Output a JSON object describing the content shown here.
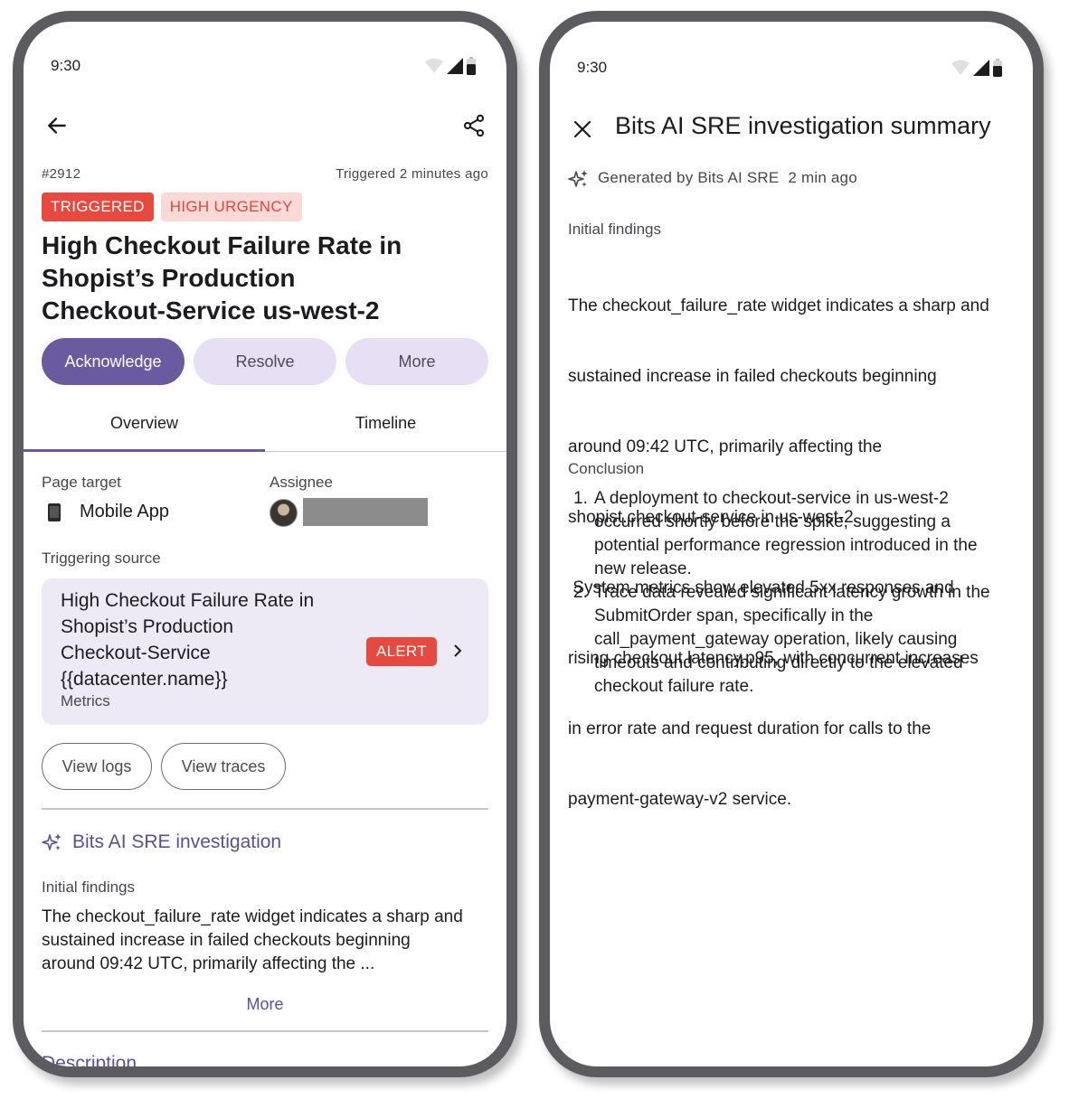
{
  "left": {
    "status_time": "9:30",
    "incident_id": "#2912",
    "triggered_time": "Triggered 2 minutes ago",
    "status_chip": "TRIGGERED",
    "urgency_chip": "HIGH URGENCY",
    "title_lines": [
      "High Checkout Failure Rate in",
      "Shopist’s Production",
      "Checkout-Service us-west-2"
    ],
    "actions": {
      "acknowledge": "Acknowledge",
      "resolve": "Resolve",
      "more": "More"
    },
    "tabs": [
      {
        "label": "Overview",
        "selected": true
      },
      {
        "label": "Timeline",
        "selected": false
      }
    ],
    "page_target_label": "Page target",
    "page_target_value": "Mobile App",
    "assignee_label": "Assignee",
    "triggering_source_label": "Triggering source",
    "source_card": {
      "lines": [
        "High Checkout Failure Rate in",
        "Shopist’s Production",
        "Checkout-Service",
        "{{datacenter.name}}"
      ],
      "subtitle": "Metrics",
      "badge": "ALERT"
    },
    "view_logs": "View logs",
    "view_traces": "View traces",
    "bits_title": "Bits AI SRE investigation",
    "initial_findings_label": "Initial findings",
    "findings_lines": [
      "The checkout_failure_rate widget indicates a sharp and",
      "sustained increase in failed checkouts beginning",
      "around 09:42 UTC, primarily affecting the ..."
    ],
    "more_link": "More",
    "description_label": "Description"
  },
  "right": {
    "status_time": "9:30",
    "title": "Bits AI SRE investigation summary",
    "generated_by": "Generated by Bits AI SRE",
    "generated_time": "2 min ago",
    "initial_findings_label": "Initial findings",
    "findings_lines": [
      "The checkout_failure_rate widget indicates a sharp and",
      "sustained increase in failed checkouts beginning",
      "around 09:42 UTC, primarily affecting the",
      "shopist.checkout-service in us-west-2.",
      " System metrics show elevated 5xx responses and",
      "rising checkout.latency.p95, with concurrent increases",
      "in error rate and request duration for calls to the",
      "payment-gateway-v2 service."
    ],
    "conclusion_label": "Conclusion",
    "conclusions": [
      {
        "num": "1.",
        "lines": [
          "A deployment to checkout-service in us-west-2",
          "occurred shortly before the spike, suggesting a",
          "potential performance regression introduced in the",
          "new release."
        ]
      },
      {
        "num": "2.",
        "lines": [
          "Trace data revealed significant latency growth in the",
          "SubmitOrder span, specifically in the",
          "call_payment_gateway operation, likely causing",
          "timeouts and contributing directly to the elevated",
          "checkout failure rate."
        ]
      }
    ]
  },
  "colors": {
    "accent": "#6a5a9f",
    "accent_text": "#5e4e95",
    "tonal": "#e7e0f4",
    "card": "#eeeaf5",
    "alert_red": "#e8493f",
    "urgency_bg": "#fbd9d6",
    "frame": "#5c5b60"
  },
  "icons": [
    "arrow-back-icon",
    "share-icon",
    "phone-device-icon",
    "avatar",
    "chevron-right-icon",
    "sparkle-icon",
    "close-icon",
    "wifi-icon",
    "signal-icon",
    "battery-icon"
  ]
}
